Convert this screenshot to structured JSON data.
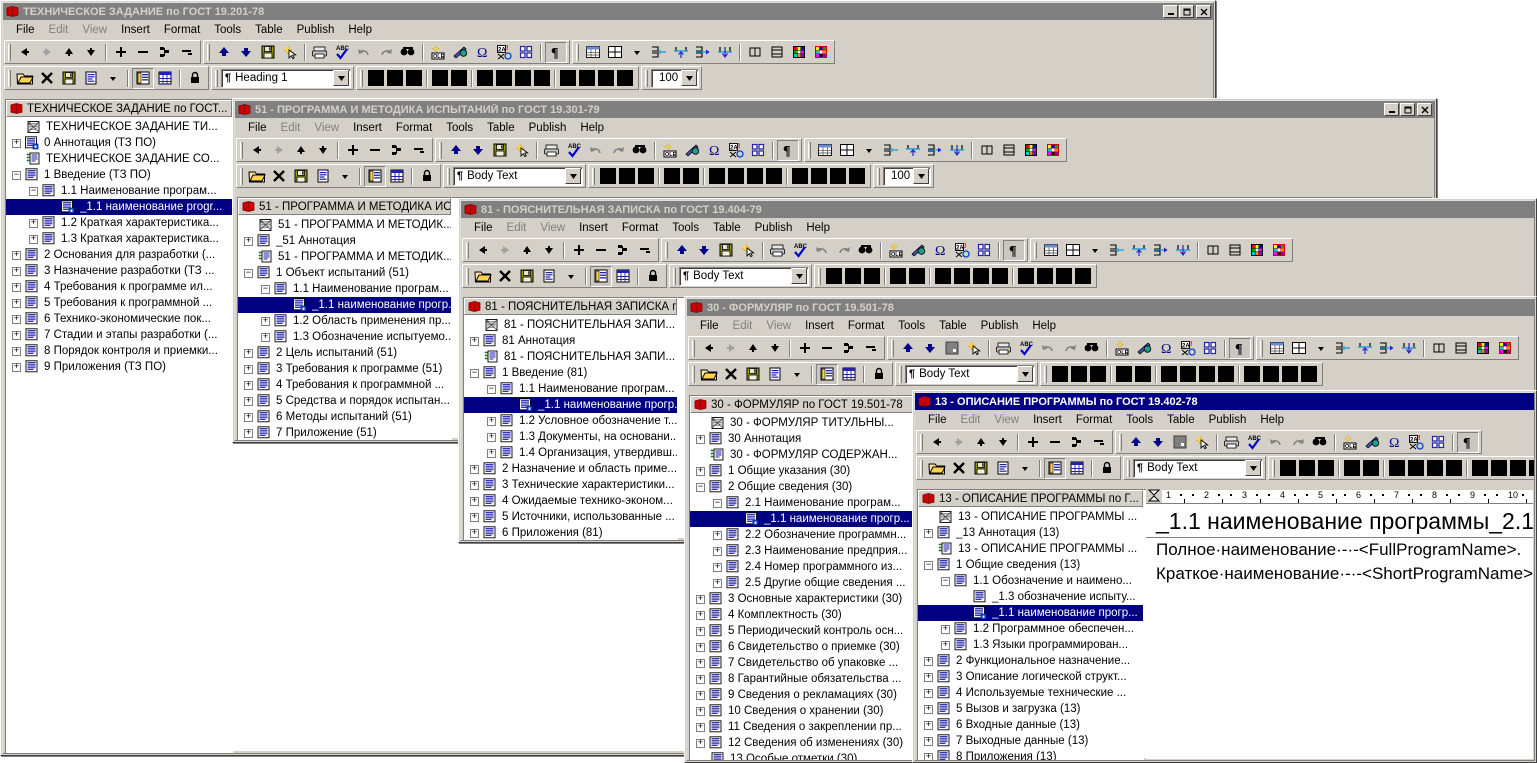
{
  "app": {
    "window_controls": {
      "minimize": "_",
      "maximize": "□",
      "close": "✕"
    },
    "menu": [
      "File",
      "Edit",
      "View",
      "Insert",
      "Format",
      "Tools",
      "Table",
      "Publish",
      "Help"
    ],
    "zoom_value": "100 %"
  },
  "windows": [
    {
      "id": "tz",
      "title": "ТЕХНИЧЕСКОЕ ЗАДАНИЕ по ГОСТ 19.201-78",
      "active": false,
      "style_value": "Heading 1",
      "tree_header": "ТЕХНИЧЕСКОЕ ЗАДАНИЕ по ГОСТ...",
      "nodes": [
        {
          "depth": 1,
          "exp": "none",
          "icon": "doc-title",
          "label": "ТЕХНИЧЕСКОЕ ЗАДАНИЕ ТИ..."
        },
        {
          "depth": 1,
          "exp": "plus",
          "icon": "doc-lock",
          "label": "0 Аннотация (ТЗ ПО)"
        },
        {
          "depth": 1,
          "exp": "none",
          "icon": "doc-toc",
          "label": "ТЕХНИЧЕСКОЕ ЗАДАНИЕ СО..."
        },
        {
          "depth": 1,
          "exp": "minus",
          "icon": "doc",
          "label": "1 Введение (ТЗ ПО)"
        },
        {
          "depth": 2,
          "exp": "minus",
          "icon": "doc",
          "label": "1.1 Наименование програм..."
        },
        {
          "depth": 3,
          "exp": "none",
          "icon": "doc-lock",
          "label": "_1.1 наименование progr...",
          "selected": true,
          "label_real": "_1.1 наименование прогр..."
        },
        {
          "depth": 2,
          "exp": "plus",
          "icon": "doc",
          "label": "1.2 Краткая характеристика..."
        },
        {
          "depth": 2,
          "exp": "plus",
          "icon": "doc",
          "label": "1.3 Краткая характеристика..."
        },
        {
          "depth": 1,
          "exp": "plus",
          "icon": "doc",
          "label": "2 Основания для разработки (..."
        },
        {
          "depth": 1,
          "exp": "plus",
          "icon": "doc",
          "label": "3 Назначение разработки (ТЗ ..."
        },
        {
          "depth": 1,
          "exp": "plus",
          "icon": "doc",
          "label": "4 Требования к программе ил..."
        },
        {
          "depth": 1,
          "exp": "plus",
          "icon": "doc",
          "label": "5 Требования к программной ..."
        },
        {
          "depth": 1,
          "exp": "plus",
          "icon": "doc",
          "label": "6 Технико-экономические пок..."
        },
        {
          "depth": 1,
          "exp": "plus",
          "icon": "doc",
          "label": "7 Стадии и этапы разработки (..."
        },
        {
          "depth": 1,
          "exp": "plus",
          "icon": "doc",
          "label": "8 Порядок контроля и приемки..."
        },
        {
          "depth": 1,
          "exp": "plus",
          "icon": "doc",
          "label": "9 Приложения (ТЗ ПО)"
        }
      ]
    },
    {
      "id": "pmi",
      "title": "51 - ПРОГРАММА И МЕТОДИКА ИСПЫТАНИЙ по ГОСТ 19.301-79",
      "active": false,
      "style_value": "Body Text",
      "tree_header": "51 - ПРОГРАММА И МЕТОДИКА ИС...",
      "nodes": [
        {
          "depth": 1,
          "exp": "none",
          "icon": "doc-title",
          "label": "51 - ПРОГРАММА И МЕТОДИК..."
        },
        {
          "depth": 1,
          "exp": "plus",
          "icon": "doc",
          "label": "_51 Аннотация"
        },
        {
          "depth": 1,
          "exp": "none",
          "icon": "doc-toc",
          "label": "51 - ПРОГРАММА И МЕТОДИК..."
        },
        {
          "depth": 1,
          "exp": "minus",
          "icon": "doc",
          "label": "1 Объект испытаний (51)"
        },
        {
          "depth": 2,
          "exp": "minus",
          "icon": "doc",
          "label": "1.1 Наименование програм..."
        },
        {
          "depth": 3,
          "exp": "none",
          "icon": "doc-lock",
          "label": "_1.1 наименование прогр...",
          "selected": true
        },
        {
          "depth": 2,
          "exp": "plus",
          "icon": "doc",
          "label": "1.2 Область применения пр..."
        },
        {
          "depth": 2,
          "exp": "plus",
          "icon": "doc",
          "label": "1.3 Обозначение испытуемо..."
        },
        {
          "depth": 1,
          "exp": "plus",
          "icon": "doc",
          "label": "2 Цель испытаний (51)"
        },
        {
          "depth": 1,
          "exp": "plus",
          "icon": "doc",
          "label": "3 Требования к программе (51)"
        },
        {
          "depth": 1,
          "exp": "plus",
          "icon": "doc",
          "label": "4 Требования к программной ..."
        },
        {
          "depth": 1,
          "exp": "plus",
          "icon": "doc",
          "label": "5 Средства и порядок испытан..."
        },
        {
          "depth": 1,
          "exp": "plus",
          "icon": "doc",
          "label": "6 Методы испытаний (51)"
        },
        {
          "depth": 1,
          "exp": "plus",
          "icon": "doc",
          "label": "7 Приложение (51)"
        }
      ]
    },
    {
      "id": "pz",
      "title": "81 - ПОЯСНИТЕЛЬНАЯ ЗАПИСКА по ГОСТ 19.404-79",
      "active": false,
      "style_value": "Body Text",
      "tree_header": "81 - ПОЯСНИТЕЛЬНАЯ ЗАПИСКА п...",
      "nodes": [
        {
          "depth": 1,
          "exp": "none",
          "icon": "doc-title",
          "label": "81 - ПОЯСНИТЕЛЬНАЯ ЗАПИ..."
        },
        {
          "depth": 1,
          "exp": "plus",
          "icon": "doc",
          "label": "81 Аннотация"
        },
        {
          "depth": 1,
          "exp": "none",
          "icon": "doc-toc",
          "label": "81 - ПОЯСНИТЕЛЬНАЯ ЗАПИ..."
        },
        {
          "depth": 1,
          "exp": "minus",
          "icon": "doc",
          "label": "1 Введение (81)"
        },
        {
          "depth": 2,
          "exp": "minus",
          "icon": "doc",
          "label": "1.1 Наименование програм..."
        },
        {
          "depth": 3,
          "exp": "none",
          "icon": "doc-lock",
          "label": "_1.1 наименование прогр...",
          "selected": true
        },
        {
          "depth": 2,
          "exp": "plus",
          "icon": "doc",
          "label": "1.2 Условное обозначение т..."
        },
        {
          "depth": 2,
          "exp": "plus",
          "icon": "doc",
          "label": "1.3 Документы, на основани..."
        },
        {
          "depth": 2,
          "exp": "plus",
          "icon": "doc",
          "label": "1.4 Организация, утвердивш..."
        },
        {
          "depth": 1,
          "exp": "plus",
          "icon": "doc",
          "label": "2 Назначение и область приме..."
        },
        {
          "depth": 1,
          "exp": "plus",
          "icon": "doc",
          "label": "3 Технические характеристики..."
        },
        {
          "depth": 1,
          "exp": "plus",
          "icon": "doc",
          "label": "4 Ожидаемые технико-эконом..."
        },
        {
          "depth": 1,
          "exp": "plus",
          "icon": "doc",
          "label": "5 Источники, использованные ..."
        },
        {
          "depth": 1,
          "exp": "plus",
          "icon": "doc",
          "label": "6 Приложения (81)"
        }
      ]
    },
    {
      "id": "form",
      "title": "30 - ФОРМУЛЯР по ГОСТ 19.501-78",
      "active": false,
      "style_value": "Body Text",
      "tree_header": "30 - ФОРМУЛЯР по ГОСТ 19.501-78",
      "nodes": [
        {
          "depth": 1,
          "exp": "none",
          "icon": "doc-title",
          "label": "30 - ФОРМУЛЯР ТИТУЛЬНЫ..."
        },
        {
          "depth": 1,
          "exp": "plus",
          "icon": "doc",
          "label": "30 Аннотация"
        },
        {
          "depth": 1,
          "exp": "none",
          "icon": "doc-toc",
          "label": "30 - ФОРМУЛЯР СОДЕРЖАН..."
        },
        {
          "depth": 1,
          "exp": "plus",
          "icon": "doc",
          "label": "1 Общие указания (30)"
        },
        {
          "depth": 1,
          "exp": "minus",
          "icon": "doc",
          "label": "2 Общие сведения (30)"
        },
        {
          "depth": 2,
          "exp": "minus",
          "icon": "doc",
          "label": "2.1 Наименование програм..."
        },
        {
          "depth": 3,
          "exp": "none",
          "icon": "doc-lock",
          "label": "_1.1 наименование прогр...",
          "selected": true
        },
        {
          "depth": 2,
          "exp": "plus",
          "icon": "doc",
          "label": "2.2 Обозначение программн..."
        },
        {
          "depth": 2,
          "exp": "plus",
          "icon": "doc",
          "label": "2.3 Наименование предприя..."
        },
        {
          "depth": 2,
          "exp": "plus",
          "icon": "doc",
          "label": "2.4 Номер программного из..."
        },
        {
          "depth": 2,
          "exp": "plus",
          "icon": "doc",
          "label": "2.5 Другие общие сведения ..."
        },
        {
          "depth": 1,
          "exp": "plus",
          "icon": "doc",
          "label": "3 Основные характеристики (30)"
        },
        {
          "depth": 1,
          "exp": "plus",
          "icon": "doc",
          "label": "4 Комплектность (30)"
        },
        {
          "depth": 1,
          "exp": "plus",
          "icon": "doc",
          "label": "5 Периодический контроль осн..."
        },
        {
          "depth": 1,
          "exp": "plus",
          "icon": "doc",
          "label": "6 Свидетельство о приемке (30)"
        },
        {
          "depth": 1,
          "exp": "plus",
          "icon": "doc",
          "label": "7 Свидетельство об упаковке ..."
        },
        {
          "depth": 1,
          "exp": "plus",
          "icon": "doc",
          "label": "8 Гарантийные обязательства ..."
        },
        {
          "depth": 1,
          "exp": "plus",
          "icon": "doc",
          "label": "9 Сведения о рекламациях (30)"
        },
        {
          "depth": 1,
          "exp": "plus",
          "icon": "doc",
          "label": "10 Сведения о хранении (30)"
        },
        {
          "depth": 1,
          "exp": "plus",
          "icon": "doc",
          "label": "11 Сведения о закреплении пр..."
        },
        {
          "depth": 1,
          "exp": "plus",
          "icon": "doc",
          "label": "12 Сведения об изменениях (30)"
        },
        {
          "depth": 1,
          "exp": "none",
          "icon": "doc",
          "label": "13 Особые отметки (30)"
        }
      ]
    },
    {
      "id": "opis",
      "title": "13 - ОПИСАНИЕ ПРОГРАММЫ по ГОСТ 19.402-78",
      "active": true,
      "style_value": "Body Text",
      "tree_header": "13 - ОПИСАНИЕ ПРОГРАММЫ по Г...",
      "nodes": [
        {
          "depth": 1,
          "exp": "none",
          "icon": "doc-title",
          "label": "13 - ОПИСАНИЕ ПРОГРАММЫ ..."
        },
        {
          "depth": 1,
          "exp": "plus",
          "icon": "doc",
          "label": "_13 Аннотация (13)"
        },
        {
          "depth": 1,
          "exp": "none",
          "icon": "doc-toc",
          "label": "13 - ОПИСАНИЕ ПРОГРАММЫ ..."
        },
        {
          "depth": 1,
          "exp": "minus",
          "icon": "doc",
          "label": "1 Общие сведения (13)"
        },
        {
          "depth": 2,
          "exp": "minus",
          "icon": "doc",
          "label": "1.1 Обозначение и наимено..."
        },
        {
          "depth": 3,
          "exp": "none",
          "icon": "doc",
          "label": "_1.3 обозначение испыту..."
        },
        {
          "depth": 3,
          "exp": "none",
          "icon": "doc-lock",
          "label": "_1.1 наименование прогр...",
          "selected": true
        },
        {
          "depth": 2,
          "exp": "plus",
          "icon": "doc",
          "label": "1.2 Программное обеспечен..."
        },
        {
          "depth": 2,
          "exp": "plus",
          "icon": "doc",
          "label": "1.3 Языки программирован..."
        },
        {
          "depth": 1,
          "exp": "plus",
          "icon": "doc",
          "label": "2 Функциональное назначение..."
        },
        {
          "depth": 1,
          "exp": "plus",
          "icon": "doc",
          "label": "3 Описание логической структ..."
        },
        {
          "depth": 1,
          "exp": "plus",
          "icon": "doc",
          "label": "4 Используемые технические ..."
        },
        {
          "depth": 1,
          "exp": "plus",
          "icon": "doc",
          "label": "5 Вызов и загрузка (13)"
        },
        {
          "depth": 1,
          "exp": "plus",
          "icon": "doc",
          "label": "6 Входные данные (13)"
        },
        {
          "depth": 1,
          "exp": "plus",
          "icon": "doc",
          "label": "7 Выходные данные (13)"
        },
        {
          "depth": 1,
          "exp": "plus",
          "icon": "doc",
          "label": "8 Приложения (13)"
        }
      ],
      "document": {
        "ruler_ticks": [
          "1",
          "2",
          "3",
          "4",
          "5",
          "6",
          "7",
          "8",
          "9",
          "10"
        ],
        "heading": "_1.1 наименование программы_2.1",
        "lines": [
          "Полное·наименование·-·-<FullProgramName>.",
          "Краткое·наименование·-·-<ShortProgramName>"
        ]
      }
    }
  ],
  "icons": {
    "back": "back-arrow-icon",
    "forward": "forward-arrow-icon",
    "up": "up-arrow-icon",
    "down": "down-arrow-icon",
    "add": "add-icon",
    "remove": "remove-icon",
    "promote": "promote-icon",
    "demote": "demote-icon",
    "open": "open-folder-icon",
    "close_doc": "close-document-icon",
    "save": "save-icon",
    "newdoc": "new-document-icon",
    "outline": "outline-view-icon",
    "table_view": "table-view-icon",
    "lock": "lock-icon",
    "move_up": "move-up-icon",
    "move_down": "move-down-icon",
    "save2": "save-icon",
    "spark": "cursor-spark-icon",
    "print": "print-icon",
    "spell": "spellcheck-icon",
    "undo": "undo-icon",
    "redo": "redo-icon",
    "find": "find-binoculars-icon",
    "ole": "insert-ole-icon",
    "image": "insert-image-icon",
    "symbol": "insert-symbol-icon",
    "special": "insert-special-icon",
    "fields": "insert-fields-icon",
    "pilcrow": "show-formatting-icon",
    "table_insert": "insert-table-icon",
    "table_grid": "table-grid-icon",
    "table_arrow": "table-dropdown-icon",
    "merge_left": "merge-cells-left-icon",
    "split_up": "split-cell-up-icon",
    "merge_right": "merge-cells-right-icon",
    "split_down": "split-cell-down-icon",
    "cell_width": "cell-width-icon",
    "row_height": "row-height-icon",
    "table_color": "table-color-icon",
    "table_autoformat": "table-autoformat-icon"
  }
}
